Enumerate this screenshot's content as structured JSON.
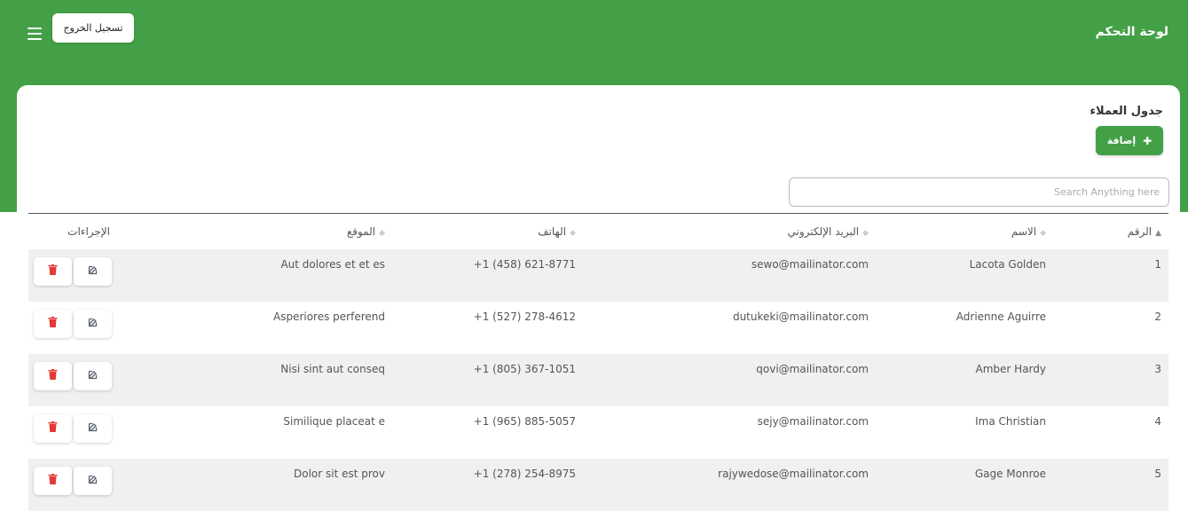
{
  "header": {
    "brand": "لوحة التحكم",
    "logout_label": "تسجيل الخروج"
  },
  "card": {
    "title": "جدول العملاء",
    "add_label": "إضافة",
    "search_placeholder": "Search Anything here"
  },
  "table": {
    "columns": [
      "الرقم",
      "الاسم",
      "البريد الإلكتروني",
      "الهاتف",
      "الموقع",
      "الإجراءات"
    ],
    "rows": [
      {
        "num": "1",
        "name": "Lacota Golden",
        "email": "sewo@mailinator.com",
        "phone": "+1 (458) 621-8771",
        "site": "Aut dolores et et es"
      },
      {
        "num": "2",
        "name": "Adrienne Aguirre",
        "email": "dutukeki@mailinator.com",
        "phone": "+1 (527) 278-4612",
        "site": "Asperiores perferend"
      },
      {
        "num": "3",
        "name": "Amber Hardy",
        "email": "qovi@mailinator.com",
        "phone": "+1 (805) 367-1051",
        "site": "Nisi sint aut conseq"
      },
      {
        "num": "4",
        "name": "Ima Christian",
        "email": "sejy@mailinator.com",
        "phone": "+1 (965) 885-5057",
        "site": "Similique placeat e"
      },
      {
        "num": "5",
        "name": "Gage Monroe",
        "email": "rajywedose@mailinator.com",
        "phone": "+1 (278) 254-8975",
        "site": "Dolor sit est prov"
      }
    ]
  },
  "colors": {
    "brand_green": "#43a047",
    "delete_red": "#e53935",
    "edit_gray": "#5a6270"
  },
  "icons": {
    "menu": "hamburger-menu-icon",
    "add": "plus-icon",
    "edit": "edit-icon",
    "delete": "trash-icon",
    "sort": "sort-arrows-icon"
  }
}
